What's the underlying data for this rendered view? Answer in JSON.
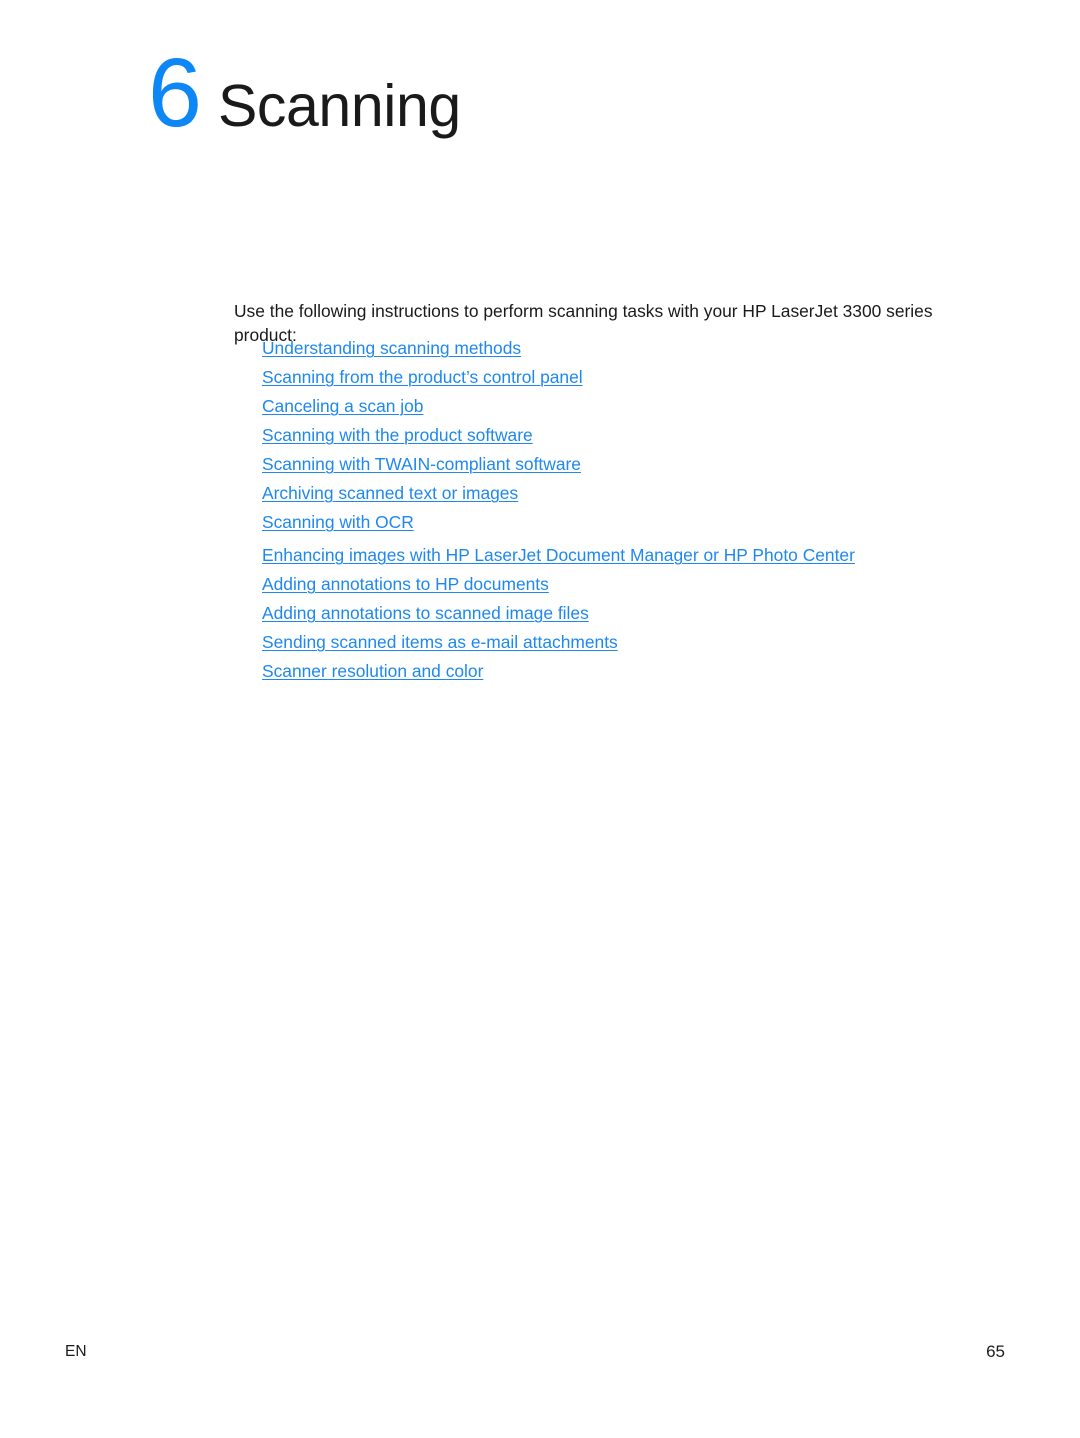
{
  "chapter": {
    "number": "6",
    "title": "Scanning",
    "number_color": "#0d87f5"
  },
  "intro": {
    "text": "Use the following instructions to perform scanning tasks with your HP LaserJet 3300 series product:"
  },
  "toc": {
    "link_color": "#1e88f0",
    "items": [
      {
        "label": "Understanding scanning methods"
      },
      {
        "label": "Scanning from the product’s control panel"
      },
      {
        "label": "Canceling a scan job"
      },
      {
        "label": "Scanning with the product software"
      },
      {
        "label": "Scanning with TWAIN-compliant software"
      },
      {
        "label": "Archiving scanned text or images"
      },
      {
        "label": "Scanning with OCR"
      },
      {
        "label": "Enhancing images with HP LaserJet Document Manager or HP Photo Center"
      },
      {
        "label": "Adding annotations to HP documents"
      },
      {
        "label": "Adding annotations to scanned image files"
      },
      {
        "label": "Sending scanned items as e-mail attachments"
      },
      {
        "label": "Scanner resolution and color"
      }
    ]
  },
  "footer": {
    "locale": "EN",
    "page_number": "65"
  }
}
